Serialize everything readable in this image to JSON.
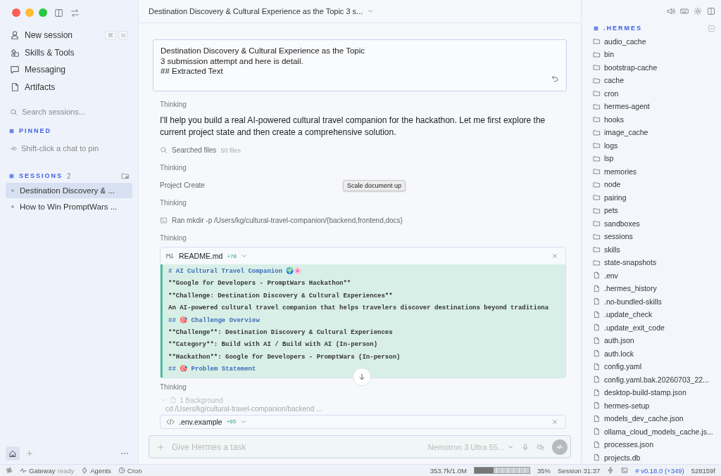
{
  "sidebar": {
    "nav": [
      {
        "kind": "person",
        "label": "New session",
        "shortcut": [
          "⌘",
          "N"
        ]
      },
      {
        "kind": "skills",
        "label": "Skills & Tools"
      },
      {
        "kind": "chat",
        "label": "Messaging"
      },
      {
        "kind": "files",
        "label": "Artifacts"
      }
    ],
    "search": {
      "placeholder": "Search sessions..."
    },
    "pinned": {
      "title": "PINNED",
      "hint": "Shift-click a chat to pin"
    },
    "sessions": {
      "title": "SESSIONS",
      "count": "2",
      "items": [
        {
          "title": "Destination Discovery & ...",
          "selected": true
        },
        {
          "title": "How to Win PromptWars ...",
          "selected": false
        }
      ]
    },
    "bottom_tabs": [
      {
        "kind": "home",
        "selected": true
      },
      {
        "kind": "add",
        "selected": false
      }
    ]
  },
  "conversation": {
    "title": "Destination Discovery & Cultural Experience as the Topic 3 s...",
    "prompt": [
      "Destination Discovery & Cultural Experience as the Topic",
      "3 submission attempt and here is detail.",
      "## Extracted Text"
    ],
    "events": [
      {
        "kind": "thinking",
        "text": "Thinking"
      },
      {
        "kind": "message",
        "text": "I'll help you build a real AI-powered cultural travel companion for the hackathon. Let me first explore the current project state and then create a comprehensive solution."
      },
      {
        "kind": "search",
        "text": "Searched files",
        "detail": "50 files"
      },
      {
        "kind": "thinking",
        "text": "Thinking"
      },
      {
        "kind": "tool",
        "text": "Project Create"
      },
      {
        "kind": "thinking",
        "text": "Thinking"
      },
      {
        "kind": "command",
        "text": "Ran mkdir -p /Users/kg/cultural-travel-companion/{backend,frontend,docs}"
      },
      {
        "kind": "thinking",
        "text": "Thinking"
      },
      {
        "kind": "markdown_file",
        "name": "README.md",
        "added": "+78",
        "lines": [
          {
            "kind": "heading",
            "text": "# AI Cultural Travel Companion 🌍🌸"
          },
          {
            "kind": "text",
            "text": "**Google for Developers - PromptWars Hackathon**"
          },
          {
            "kind": "text",
            "text": "**Challenge: Destination Discovery & Cultural Experiences**"
          },
          {
            "kind": "text",
            "text": "An AI-powered cultural travel companion that helps travelers discover destinations beyond traditiona"
          },
          {
            "kind": "heading",
            "text": "## 🎯 Challenge Overview"
          },
          {
            "kind": "text",
            "text": "**Challenge**: Destination Discovery & Cultural Experiences"
          },
          {
            "kind": "text",
            "text": "**Category**: Build with AI / Build with AI (In-person)"
          },
          {
            "kind": "text",
            "text": "**Hackathon**: Google for Developers - PromptWars (In-person)"
          },
          {
            "kind": "heading",
            "text": "## 🎯 Problem Statement"
          }
        ]
      },
      {
        "kind": "thinking",
        "text": "Thinking"
      },
      {
        "kind": "background",
        "text": "1 Background",
        "detail": "cd /Users/kg/cultural-travel-companion/backend ..."
      },
      {
        "kind": "code_file",
        "name": ".env.example",
        "added": "+65"
      }
    ]
  },
  "tooltip": "Scale document up",
  "composer": {
    "placeholder": "Give Hermes a task",
    "model": "Nemotron 3 Ultra 55..."
  },
  "explorer": {
    "title": ".HERMES",
    "items": [
      {
        "kind": "folder",
        "name": "audio_cache"
      },
      {
        "kind": "folder",
        "name": "bin"
      },
      {
        "kind": "folder",
        "name": "bootstrap-cache"
      },
      {
        "kind": "folder",
        "name": "cache"
      },
      {
        "kind": "folder",
        "name": "cron"
      },
      {
        "kind": "folder",
        "name": "hermes-agent"
      },
      {
        "kind": "folder",
        "name": "hooks"
      },
      {
        "kind": "folder",
        "name": "image_cache"
      },
      {
        "kind": "folder",
        "name": "logs"
      },
      {
        "kind": "folder",
        "name": "lsp"
      },
      {
        "kind": "folder",
        "name": "memories"
      },
      {
        "kind": "folder",
        "name": "node"
      },
      {
        "kind": "folder",
        "name": "pairing"
      },
      {
        "kind": "folder",
        "name": "pets"
      },
      {
        "kind": "folder",
        "name": "sandboxes"
      },
      {
        "kind": "folder",
        "name": "sessions"
      },
      {
        "kind": "folder",
        "name": "skills"
      },
      {
        "kind": "folder",
        "name": "state-snapshots"
      },
      {
        "kind": "file",
        "name": ".env"
      },
      {
        "kind": "file",
        "name": ".hermes_history"
      },
      {
        "kind": "file",
        "name": ".no-bundled-skills"
      },
      {
        "kind": "file",
        "name": ".update_check"
      },
      {
        "kind": "file",
        "name": ".update_exit_code"
      },
      {
        "kind": "file",
        "name": "auth.json"
      },
      {
        "kind": "file",
        "name": "auth.lock"
      },
      {
        "kind": "file",
        "name": "config.yaml"
      },
      {
        "kind": "file",
        "name": "config.yaml.bak.20260703_22..."
      },
      {
        "kind": "file",
        "name": "desktop-build-stamp.json"
      },
      {
        "kind": "file",
        "name": "hermes-setup"
      },
      {
        "kind": "file",
        "name": "models_dev_cache.json"
      },
      {
        "kind": "file",
        "name": "ollama_cloud_models_cache.js..."
      },
      {
        "kind": "file",
        "name": "processes.json"
      },
      {
        "kind": "file",
        "name": "projects.db"
      }
    ]
  },
  "status_bar": {
    "gateway": "Gateway",
    "gateway_state": "ready",
    "agents": "Agents",
    "cron": "Cron",
    "tokens": "353.7k/1.0M",
    "context": {
      "level": 0.35
    },
    "percent": "35%",
    "session": "Session 31:37",
    "version": "# v0.18.0 (+349)",
    "commit": "528159f"
  }
}
